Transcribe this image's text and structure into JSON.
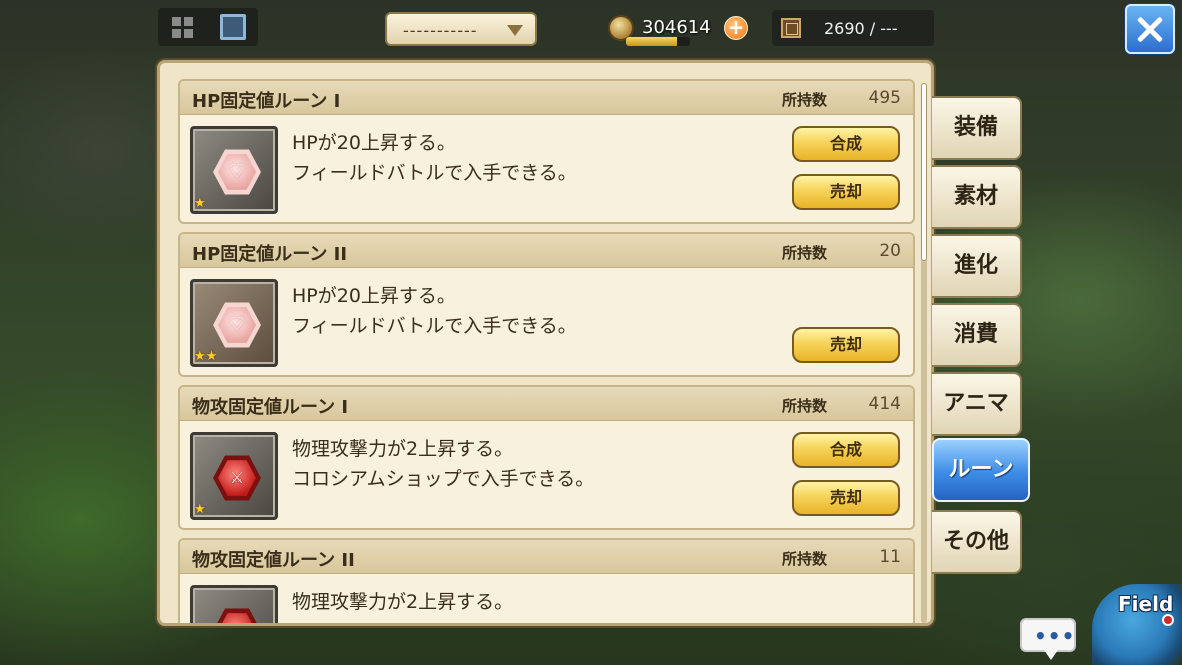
{
  "topbar": {
    "filter_label": "-----------",
    "gold_value": "304614",
    "gold_progress": 0.8,
    "plus_label": "+",
    "capacity_value": "2690 / ---"
  },
  "cards": [
    {
      "title": "HP固定値ルーン I",
      "qty_label": "所持数",
      "qty_value": "495",
      "desc1": "HPが20上昇する。",
      "desc2": "フィールドバトルで入手できる。",
      "stars": "★",
      "icon": "hp-rune-icon",
      "buttons": [
        "合成",
        "売却"
      ]
    },
    {
      "title": "HP固定値ルーン II",
      "qty_label": "所持数",
      "qty_value": "20",
      "desc1": "HPが20上昇する。",
      "desc2": "フィールドバトルで入手できる。",
      "stars": "★★",
      "icon": "hp-rune-icon",
      "buttons": [
        "売却"
      ]
    },
    {
      "title": "物攻固定値ルーン I",
      "qty_label": "所持数",
      "qty_value": "414",
      "desc1": "物理攻撃力が2上昇する。",
      "desc2": "コロシアムショップで入手できる。",
      "stars": "★",
      "icon": "attack-rune-icon",
      "buttons": [
        "合成",
        "売却"
      ]
    },
    {
      "title": "物攻固定値ルーン II",
      "qty_label": "所持数",
      "qty_value": "11",
      "desc1": "物理攻撃力が2上昇する。",
      "desc2": "",
      "stars": "",
      "icon": "attack-rune-icon",
      "buttons": []
    }
  ],
  "tabs": {
    "equip": "装備",
    "material": "素材",
    "evolve": "進化",
    "consume": "消費",
    "anima": "アニマ",
    "rune": "ルーン",
    "other": "その他"
  },
  "active_tab": "ルーン",
  "widgets": {
    "chat_label": "•••",
    "field_label": "Field"
  },
  "colors": {
    "accent_blue": "#3d8ce6",
    "button_gold": "#f6d35a",
    "panel_bg": "#efe5c9",
    "star": "#ffcf2a"
  }
}
